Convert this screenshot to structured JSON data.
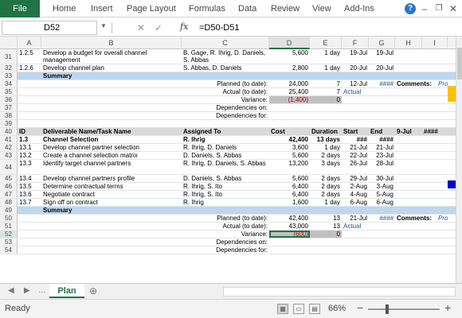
{
  "ribbon": {
    "file": "File",
    "tabs": [
      "Home",
      "Insert",
      "Page Layout",
      "Formulas",
      "Data",
      "Review",
      "View",
      "Add-Ins"
    ],
    "icons": [
      "help-icon",
      "minimize-icon",
      "restore-icon",
      "close-icon"
    ]
  },
  "formula_bar": {
    "name_box": "D52",
    "fx": "fx",
    "formula": "=D50-D51"
  },
  "columns": [
    "A",
    "B",
    "C",
    "D",
    "E",
    "F",
    "G",
    "H",
    "I"
  ],
  "selected_column": "D",
  "rows": [
    {
      "n": "31",
      "a": "1.2.5",
      "b": "Develop a budget for overall channel management",
      "c": "B. Gage, R. Ihrig, D. Daniels, S. Abbas",
      "d": "5,600",
      "e": "1 day",
      "f": "19-Jul",
      "g": "19-Jul"
    },
    {
      "n": "32",
      "a": "1.2.6",
      "b": "Develop channel plan",
      "c": "S. Abbas, D. Daniels",
      "d": "2,800",
      "e": "1 day",
      "f": "20-Jul",
      "g": "20-Jul"
    },
    {
      "n": "33",
      "a": "",
      "b": "Summary",
      "c": "",
      "d": "",
      "e": "",
      "f": "",
      "g": "",
      "kind": "summary"
    },
    {
      "n": "34",
      "a": "",
      "b": "",
      "c": "Planned (to date):",
      "d": "24,000",
      "e": "7",
      "f": "12-Jul",
      "g": "####",
      "h": "Comments:",
      "i": "Pro"
    },
    {
      "n": "35",
      "a": "",
      "b": "",
      "c": "Actual (to date):",
      "d": "25,400",
      "e": "7",
      "f": "Actual",
      "g": ""
    },
    {
      "n": "36",
      "a": "",
      "b": "",
      "c": "Variance:",
      "d": "(1,400)",
      "e": "0",
      "f": "",
      "g": "",
      "kind": "variance"
    },
    {
      "n": "37",
      "a": "",
      "b": "",
      "c": "Dependencies on:",
      "d": "",
      "e": "",
      "f": "",
      "g": ""
    },
    {
      "n": "38",
      "a": "",
      "b": "",
      "c": "Dependencies for:",
      "d": "",
      "e": "",
      "f": "",
      "g": ""
    },
    {
      "n": "39",
      "a": "",
      "b": "",
      "c": "",
      "d": "",
      "e": "",
      "f": "",
      "g": ""
    },
    {
      "n": "40",
      "a": "ID",
      "b": "Deliverable Name/Task Name",
      "c": "Assigned To",
      "d": "Cost",
      "e": "Duration",
      "f": "Start",
      "g": "End",
      "h": "9-Jul",
      "i": "####",
      "kind": "header"
    },
    {
      "n": "41",
      "a": "1.3",
      "b": "Channel Selection",
      "c": "R. Ihrig",
      "d": "42,400",
      "e": "13 days",
      "f": "###",
      "g": "####",
      "kind": "bold"
    },
    {
      "n": "42",
      "a": "13.1",
      "b": "Develop channel partner selection",
      "c": "R. Ihrig, D. Daniels",
      "d": "3,600",
      "e": "1 day",
      "f": "21-Jul",
      "g": "21-Jul"
    },
    {
      "n": "43",
      "a": "13.2",
      "b": "Create a channel selection matrix",
      "c": "D. Daniels, S. Abbas",
      "d": "5,600",
      "e": "2 days",
      "f": "22-Jul",
      "g": "23-Jul"
    },
    {
      "n": "44",
      "a": "13.3",
      "b": "Identify target channel partners",
      "c": "R. Ihrig, D. Daniels, S. Abbas",
      "d": "13,200",
      "e": "3 days",
      "f": "26-Jul",
      "g": "28-Jul"
    },
    {
      "n": "45",
      "a": "13.4",
      "b": "Develop channel partners profile",
      "c": "D. Daniels, S. Abbas",
      "d": "5,600",
      "e": "2 days",
      "f": "29-Jul",
      "g": "30-Jul"
    },
    {
      "n": "46",
      "a": "13.5",
      "b": "Determine contractual terms",
      "c": "R. Ihrig, S. Ito",
      "d": "6,400",
      "e": "2 days",
      "f": "2-Aug",
      "g": "3-Aug"
    },
    {
      "n": "47",
      "a": "13.6",
      "b": "Negotiate contract",
      "c": "R. Ihrig, S. Ito",
      "d": "6,400",
      "e": "2 days",
      "f": "4-Aug",
      "g": "5-Aug"
    },
    {
      "n": "48",
      "a": "13.7",
      "b": "Sign off on contract",
      "c": "R. Ihrig",
      "d": "1,600",
      "e": "1 day",
      "f": "6-Aug",
      "g": "6-Aug"
    },
    {
      "n": "49",
      "a": "",
      "b": "Summary",
      "c": "",
      "d": "",
      "e": "",
      "f": "",
      "g": "",
      "kind": "summary"
    },
    {
      "n": "50",
      "a": "",
      "b": "",
      "c": "Planned (to date):",
      "d": "42,400",
      "e": "13",
      "f": "21-Jul",
      "g": "####",
      "h": "Comments:",
      "i": "Pro"
    },
    {
      "n": "51",
      "a": "",
      "b": "",
      "c": "Actual (to date):",
      "d": "43,000",
      "e": "13",
      "f": "Actual",
      "g": ""
    },
    {
      "n": "52",
      "a": "",
      "b": "",
      "c": "Variance:",
      "d": "(600)",
      "e": "0",
      "f": "",
      "g": "",
      "kind": "variance-sel"
    },
    {
      "n": "53",
      "a": "",
      "b": "",
      "c": "Dependencies on:",
      "d": "",
      "e": "",
      "f": "",
      "g": ""
    },
    {
      "n": "54",
      "a": "",
      "b": "",
      "c": "Dependencies for:",
      "d": "",
      "e": "",
      "f": "",
      "g": ""
    }
  ],
  "sheet_tab": "Plan",
  "status": {
    "ready": "Ready",
    "zoom": "66%"
  },
  "colors": {
    "excel_green": "#217346",
    "summary_band": "#bdd7ee",
    "header_band": "#d9d9d9",
    "variance_fill": "#c0c0c0",
    "negative_text": "#c00000",
    "accent_bar": "#ffc000"
  }
}
